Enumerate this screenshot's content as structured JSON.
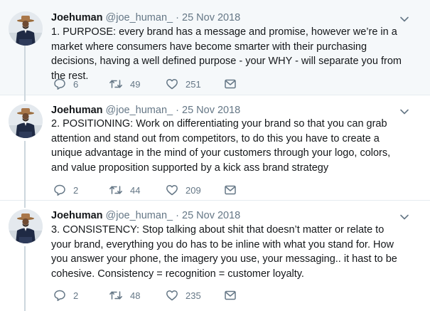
{
  "tweets": [
    {
      "display_name": "Joehuman",
      "handle": "@joe_human_",
      "separator": "·",
      "date": "25 Nov 2018",
      "text": "1. PURPOSE: every brand has a message and promise, however we’re in a market where consumers have become smarter with their purchasing decisions, having a well defined purpose - your WHY - will separate you from the rest.",
      "replies": "6",
      "retweets": "49",
      "likes": "251"
    },
    {
      "display_name": "Joehuman",
      "handle": "@joe_human_",
      "separator": "·",
      "date": "25 Nov 2018",
      "text": "2. POSITIONING: Work on differentiating your brand so that you can grab attention and stand out from competitors, to do this you have to create a unique advantage in the mind of your customers through your logo, colors, and value proposition supported by a kick ass brand strategy",
      "replies": "2",
      "retweets": "44",
      "likes": "209"
    },
    {
      "display_name": "Joehuman",
      "handle": "@joe_human_",
      "separator": "·",
      "date": "25 Nov 2018",
      "text": "3. CONSISTENCY: Stop talking about shit that doesn’t matter or relate to your brand, everything you do has to be inline with what you stand for. How you answer your phone, the imagery you use, your messaging.. it hast to be cohesive. Consistency = recognition = customer loyalty.",
      "replies": "2",
      "retweets": "48",
      "likes": "235"
    }
  ],
  "icons": {
    "reply": "reply-icon",
    "retweet": "retweet-icon",
    "like": "like-icon",
    "message": "direct-message-icon",
    "more": "chevron-down-icon"
  },
  "colors": {
    "highlight_background": "#f5f8fa",
    "secondary_text": "#657786",
    "divider": "#e6ecf0",
    "thread_line": "#ccd6dd"
  }
}
